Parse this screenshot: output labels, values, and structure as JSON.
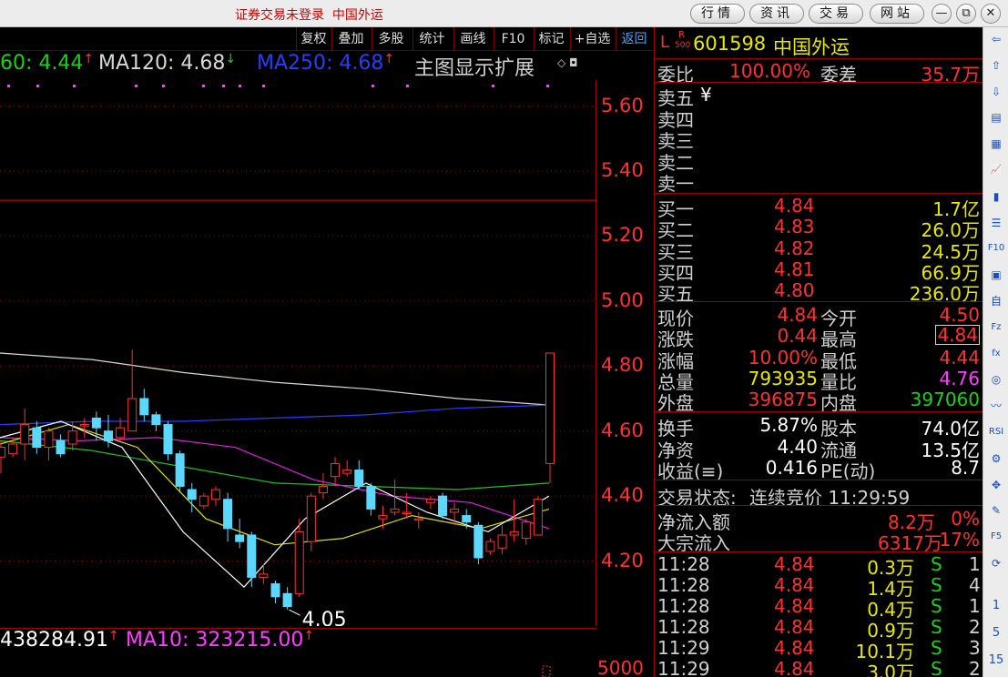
{
  "title": {
    "login_text": "证券交易未登录",
    "stock_name": "中国外运"
  },
  "top_buttons": [
    "行情",
    "资讯",
    "交易",
    "网站"
  ],
  "window_buttons": [
    {
      "name": "minimize-button",
      "glyph": "—"
    },
    {
      "name": "restore-button",
      "glyph": "⧉"
    },
    {
      "name": "close-button",
      "glyph": "✕"
    }
  ],
  "chart_toolbar": [
    "复权",
    "叠加",
    "多股",
    "统计",
    "画线",
    "F10",
    "标记",
    "+自选",
    "返回"
  ],
  "ma_header": {
    "ma60": "60: 4.44",
    "ma120": "MA120: 4.68",
    "ma250": "MA250: 4.68",
    "ext": "主图显示扩展"
  },
  "price_axis": [
    "5.60",
    "5.40",
    "5.20",
    "5.00",
    "4.80",
    "4.60",
    "4.40",
    "4.20"
  ],
  "low_label": "4.05",
  "volume_header": {
    "mavol5": "438284.91",
    "ma10": "MA10: 323215.00"
  },
  "volume_axis_label": "5000",
  "panel": {
    "code_prefix": "L",
    "badge_top": "R",
    "badge_bottom": "500",
    "code": "601598",
    "name": "中国外运",
    "weibi_label": "委比",
    "weibi_value": "100.00%",
    "weicha_label": "委差",
    "weicha_value": "35.7万",
    "sell": [
      {
        "label": "卖五",
        "price": "¥",
        "vol": ""
      },
      {
        "label": "卖四",
        "price": "",
        "vol": ""
      },
      {
        "label": "卖三",
        "price": "",
        "vol": ""
      },
      {
        "label": "卖二",
        "price": "",
        "vol": ""
      },
      {
        "label": "卖一",
        "price": "",
        "vol": ""
      }
    ],
    "buy": [
      {
        "label": "买一",
        "price": "4.84",
        "vol": "1.7亿"
      },
      {
        "label": "买二",
        "price": "4.83",
        "vol": "26.0万"
      },
      {
        "label": "买三",
        "price": "4.82",
        "vol": "24.5万"
      },
      {
        "label": "买四",
        "price": "4.81",
        "vol": "66.9万"
      },
      {
        "label": "买五",
        "price": "4.80",
        "vol": "236.0万"
      }
    ],
    "stats": [
      {
        "l1": "现价",
        "v1": "4.84",
        "c1": "red",
        "l2": "今开",
        "v2": "4.50",
        "c2": "red"
      },
      {
        "l1": "涨跌",
        "v1": "0.44",
        "c1": "red",
        "l2": "最高",
        "v2": "4.84",
        "c2": "red"
      },
      {
        "l1": "涨幅",
        "v1": "10.00%",
        "c1": "red",
        "l2": "最低",
        "v2": "4.44",
        "c2": "red"
      },
      {
        "l1": "总量",
        "v1": "793935",
        "c1": "yellow",
        "l2": "量比",
        "v2": "4.76",
        "c2": "magenta"
      },
      {
        "l1": "外盘",
        "v1": "396875",
        "c1": "red",
        "l2": "内盘",
        "v2": "397060",
        "c2": "green"
      }
    ],
    "fund": [
      {
        "l1": "换手",
        "v1": "5.87%",
        "l2": "股本",
        "v2": "74.0亿"
      },
      {
        "l1": "净资",
        "v1": "4.40",
        "l2": "流通",
        "v2": "13.5亿"
      },
      {
        "l1": "收益(≡)",
        "v1": "0.416",
        "l2": "PE(动)",
        "v2": "8.7"
      }
    ],
    "trade_status_label": "交易状态:",
    "trade_status_value": "连续竞价 11:29:59",
    "net_inflow_label": "净流入额",
    "net_inflow_value": "8.2万",
    "net_inflow_pct": "0%",
    "block_inflow_label": "大宗流入",
    "block_inflow_value": "6317万",
    "block_inflow_pct": "17%",
    "ticks": [
      {
        "time": "11:28",
        "price": "4.84",
        "vol": "0.3万",
        "side": "S",
        "n": "1"
      },
      {
        "time": "11:28",
        "price": "4.84",
        "vol": "1.4万",
        "side": "S",
        "n": "4"
      },
      {
        "time": "11:28",
        "price": "4.84",
        "vol": "0.4万",
        "side": "S",
        "n": "1"
      },
      {
        "time": "11:28",
        "price": "4.84",
        "vol": "0.9万",
        "side": "S",
        "n": "2"
      },
      {
        "time": "11:29",
        "price": "4.84",
        "vol": "10.1万",
        "side": "S",
        "n": "3"
      },
      {
        "time": "11:29",
        "price": "4.84",
        "vol": "3.0万",
        "side": "S",
        "n": "2"
      }
    ]
  },
  "sidebar": {
    "icons": [
      {
        "name": "arrow-left-icon",
        "glyph": "⇦"
      },
      {
        "name": "arrow-up-icon",
        "glyph": "⇧"
      },
      {
        "name": "arrow-down-icon",
        "glyph": "⇩"
      },
      {
        "name": "report-icon",
        "glyph": "▤"
      },
      {
        "name": "table-icon",
        "glyph": "▦"
      },
      {
        "name": "line-chart-icon",
        "glyph": "📈"
      },
      {
        "name": "kline-icon",
        "glyph": "▮"
      },
      {
        "name": "list-icon",
        "glyph": "☰"
      },
      {
        "name": "f10-icon",
        "glyph": "F10"
      },
      {
        "name": "news-icon",
        "glyph": "▣"
      },
      {
        "name": "self-select-icon",
        "glyph": "自"
      },
      {
        "name": "fz-icon",
        "glyph": "Fz"
      },
      {
        "name": "function-icon",
        "glyph": "fx"
      },
      {
        "name": "settings-icon",
        "glyph": "◎"
      },
      {
        "name": "wave-icon",
        "glyph": "〰"
      },
      {
        "name": "rsi-icon",
        "glyph": "RSI"
      },
      {
        "name": "tools-icon",
        "glyph": "⚙"
      },
      {
        "name": "move-icon",
        "glyph": "✥"
      },
      {
        "name": "pencil-icon",
        "glyph": "✎"
      },
      {
        "name": "f5-icon",
        "glyph": "F5"
      },
      {
        "name": "refresh-icon",
        "glyph": "⟳"
      }
    ],
    "numbers": [
      "1",
      "5",
      "15"
    ]
  },
  "chart_data": {
    "type": "candlestick",
    "ylim": [
      4.0,
      5.68
    ],
    "candles": [
      {
        "o": 4.52,
        "h": 4.57,
        "l": 4.47,
        "c": 4.55
      },
      {
        "o": 4.53,
        "h": 4.58,
        "l": 4.52,
        "c": 4.56
      },
      {
        "o": 4.56,
        "h": 4.67,
        "l": 4.51,
        "c": 4.62
      },
      {
        "o": 4.61,
        "h": 4.63,
        "l": 4.53,
        "c": 4.55
      },
      {
        "o": 4.55,
        "h": 4.61,
        "l": 4.51,
        "c": 4.6
      },
      {
        "o": 4.57,
        "h": 4.59,
        "l": 4.52,
        "c": 4.53
      },
      {
        "o": 4.56,
        "h": 4.63,
        "l": 4.54,
        "c": 4.6
      },
      {
        "o": 4.62,
        "h": 4.64,
        "l": 4.58,
        "c": 4.62
      },
      {
        "o": 4.64,
        "h": 4.66,
        "l": 4.57,
        "c": 4.61
      },
      {
        "o": 4.6,
        "h": 4.65,
        "l": 4.55,
        "c": 4.57
      },
      {
        "o": 4.58,
        "h": 4.64,
        "l": 4.57,
        "c": 4.61
      },
      {
        "o": 4.6,
        "h": 4.85,
        "l": 4.6,
        "c": 4.7
      },
      {
        "o": 4.7,
        "h": 4.73,
        "l": 4.63,
        "c": 4.65
      },
      {
        "o": 4.65,
        "h": 4.66,
        "l": 4.6,
        "c": 4.62
      },
      {
        "o": 4.62,
        "h": 4.63,
        "l": 4.51,
        "c": 4.53
      },
      {
        "o": 4.53,
        "h": 4.54,
        "l": 4.41,
        "c": 4.43
      },
      {
        "o": 4.42,
        "h": 4.44,
        "l": 4.35,
        "c": 4.39
      },
      {
        "o": 4.37,
        "h": 4.41,
        "l": 4.36,
        "c": 4.4
      },
      {
        "o": 4.39,
        "h": 4.43,
        "l": 4.37,
        "c": 4.42
      },
      {
        "o": 4.39,
        "h": 4.41,
        "l": 4.26,
        "c": 4.3
      },
      {
        "o": 4.28,
        "h": 4.33,
        "l": 4.24,
        "c": 4.26
      },
      {
        "o": 4.28,
        "h": 4.29,
        "l": 4.12,
        "c": 4.15
      },
      {
        "o": 4.15,
        "h": 4.19,
        "l": 4.13,
        "c": 4.16
      },
      {
        "o": 4.13,
        "h": 4.14,
        "l": 4.07,
        "c": 4.09
      },
      {
        "o": 4.1,
        "h": 4.12,
        "l": 4.05,
        "c": 4.06
      },
      {
        "o": 4.1,
        "h": 4.33,
        "l": 4.09,
        "c": 4.29
      },
      {
        "o": 4.26,
        "h": 4.41,
        "l": 4.23,
        "c": 4.4
      },
      {
        "o": 4.41,
        "h": 4.47,
        "l": 4.39,
        "c": 4.43
      },
      {
        "o": 4.46,
        "h": 4.52,
        "l": 4.43,
        "c": 4.5
      },
      {
        "o": 4.47,
        "h": 4.51,
        "l": 4.46,
        "c": 4.48
      },
      {
        "o": 4.48,
        "h": 4.51,
        "l": 4.42,
        "c": 4.43
      },
      {
        "o": 4.43,
        "h": 4.44,
        "l": 4.34,
        "c": 4.36
      },
      {
        "o": 4.33,
        "h": 4.37,
        "l": 4.3,
        "c": 4.34
      },
      {
        "o": 4.35,
        "h": 4.45,
        "l": 4.34,
        "c": 4.36
      },
      {
        "o": 4.35,
        "h": 4.41,
        "l": 4.33,
        "c": 4.35
      },
      {
        "o": 4.33,
        "h": 4.35,
        "l": 4.3,
        "c": 4.33
      },
      {
        "o": 4.38,
        "h": 4.4,
        "l": 4.36,
        "c": 4.39
      },
      {
        "o": 4.4,
        "h": 4.41,
        "l": 4.33,
        "c": 4.34
      },
      {
        "o": 4.35,
        "h": 4.38,
        "l": 4.31,
        "c": 4.36
      },
      {
        "o": 4.34,
        "h": 4.36,
        "l": 4.3,
        "c": 4.32
      },
      {
        "o": 4.31,
        "h": 4.32,
        "l": 4.19,
        "c": 4.21
      },
      {
        "o": 4.23,
        "h": 4.27,
        "l": 4.22,
        "c": 4.26
      },
      {
        "o": 4.24,
        "h": 4.31,
        "l": 4.22,
        "c": 4.28
      },
      {
        "o": 4.28,
        "h": 4.39,
        "l": 4.26,
        "c": 4.29
      },
      {
        "o": 4.27,
        "h": 4.33,
        "l": 4.25,
        "c": 4.32
      },
      {
        "o": 4.28,
        "h": 4.4,
        "l": 4.28,
        "c": 4.39
      },
      {
        "o": 4.5,
        "h": 4.84,
        "l": 4.44,
        "c": 4.84
      }
    ],
    "limit_line": 5.31,
    "ma_series": [
      {
        "name": "MA120",
        "color": "#d8d8d8",
        "values": [
          4.84,
          4.82,
          4.78,
          4.75,
          4.73,
          4.7,
          4.68
        ]
      },
      {
        "name": "MA250",
        "color": "#2a3cff",
        "values": [
          4.62,
          4.63,
          4.63,
          4.64,
          4.65,
          4.67,
          4.68
        ]
      },
      {
        "name": "MA60",
        "color": "#20c020",
        "values": [
          4.57,
          4.54,
          4.49,
          4.44,
          4.43,
          4.42,
          4.44
        ]
      },
      {
        "name": "MA20",
        "color": "#e020e0",
        "values": [
          4.58,
          4.57,
          4.58,
          4.55,
          4.45,
          4.4,
          4.38,
          4.3
        ]
      },
      {
        "name": "MA10",
        "color": "#e0e000",
        "values": [
          4.56,
          4.62,
          4.55,
          4.33,
          4.25,
          4.27,
          4.34,
          4.3,
          4.36
        ]
      },
      {
        "name": "MA5",
        "color": "#ffffff",
        "values": [
          4.58,
          4.63,
          4.55,
          4.29,
          4.12,
          4.33,
          4.44,
          4.35,
          4.29,
          4.4
        ]
      }
    ]
  }
}
